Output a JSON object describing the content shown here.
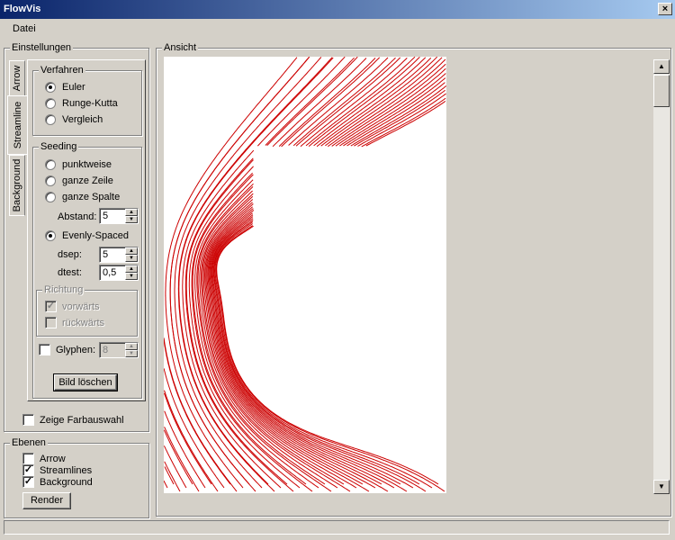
{
  "window": {
    "title": "FlowVis",
    "close_glyph": "×"
  },
  "menu": {
    "items": [
      "Datei"
    ]
  },
  "settings": {
    "title": "Einstellungen",
    "tabs": [
      "Arrow",
      "Streamline",
      "Background"
    ],
    "active_tab": "Streamline",
    "verfahren": {
      "title": "Verfahren",
      "options": [
        "Euler",
        "Runge-Kutta",
        "Vergleich"
      ],
      "selected": "Euler"
    },
    "seeding": {
      "title": "Seeding",
      "options": [
        "punktweise",
        "ganze Zeile",
        "ganze Spalte"
      ],
      "abstand_label": "Abstand:",
      "abstand_value": "5",
      "evenly_label": "Evenly-Spaced",
      "selected": "Evenly-Spaced",
      "dsep_label": "dsep:",
      "dsep_value": "5",
      "dtest_label": "dtest:",
      "dtest_value": "0,5",
      "richtung": {
        "title": "Richtung",
        "forward_label": "vorwärts",
        "forward_checked": true,
        "backward_label": "rückwärts",
        "backward_checked": false
      },
      "glyphen_label": "Glyphen:",
      "glyphen_checked": false,
      "glyphen_value": "8",
      "clear_button": "Bild löschen"
    },
    "color_choice_label": "Zeige Farbauswahl",
    "color_choice_checked": false
  },
  "layers": {
    "title": "Ebenen",
    "items": [
      {
        "label": "Arrow",
        "checked": false
      },
      {
        "label": "Streamlines",
        "checked": true
      },
      {
        "label": "Background",
        "checked": true
      }
    ],
    "render_button": "Render"
  },
  "view": {
    "title": "Ansicht",
    "stroke_color": "#cc0000",
    "scroll_up_icon": "▲",
    "scroll_down_icon": "▼"
  },
  "check_glyph": "✓"
}
